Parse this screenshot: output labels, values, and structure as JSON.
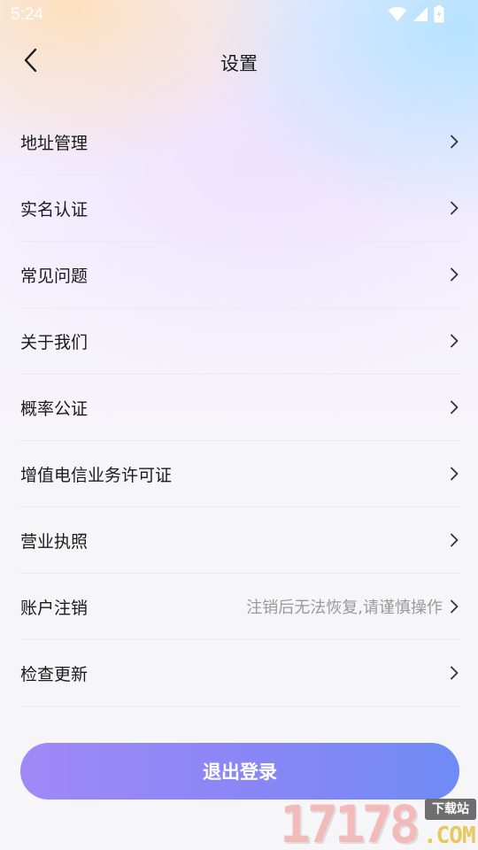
{
  "status_bar": {
    "time": "5:24"
  },
  "header": {
    "title": "设置"
  },
  "menu": {
    "items": [
      {
        "label": "地址管理",
        "hint": ""
      },
      {
        "label": "实名认证",
        "hint": ""
      },
      {
        "label": "常见问题",
        "hint": ""
      },
      {
        "label": "关于我们",
        "hint": ""
      },
      {
        "label": "概率公证",
        "hint": ""
      },
      {
        "label": "增值电信业务许可证",
        "hint": ""
      },
      {
        "label": "营业执照",
        "hint": ""
      },
      {
        "label": "账户注销",
        "hint": "注销后无法恢复,请谨慎操作"
      },
      {
        "label": "检查更新",
        "hint": ""
      }
    ]
  },
  "logout": {
    "label": "退出登录"
  },
  "watermark": {
    "digits": "17178",
    "tag": "下载站",
    "domain": ".COM"
  },
  "icons": {
    "back": "chevron-left-icon",
    "item_arrow": "chevron-right-icon",
    "wifi": "wifi-icon",
    "signal": "cell-signal-icon",
    "battery": "battery-icon"
  },
  "colors": {
    "logout_gradient_start": "#a089f7",
    "logout_gradient_end": "#6f8bf5",
    "hint_text": "#9a9a9a"
  }
}
